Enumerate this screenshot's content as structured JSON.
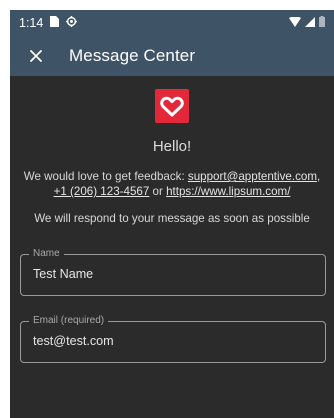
{
  "status_bar": {
    "time": "1:14",
    "left_icons": [
      "sim-card-icon",
      "settings-gear-icon"
    ],
    "right_icons": [
      "wifi-icon",
      "cell-signal-icon",
      "battery-icon"
    ]
  },
  "app_bar": {
    "close_icon": "close-icon",
    "title": "Message Center"
  },
  "colors": {
    "app_bar_bg": "#3e5366",
    "content_bg": "#2b2b2b",
    "logo_bg": "#e3283a"
  },
  "greeting": "Hello!",
  "feedback": {
    "prefix": "We would love to get feedback: ",
    "email_link": "support@apptentive.com",
    "separator": ", ",
    "phone_link": "+1 (206) 123-4567",
    "or_text": " or ",
    "url_link": "https://www.lipsum.com/"
  },
  "respond_text": "We will respond to your message as soon as possible",
  "form": {
    "name": {
      "label": "Name",
      "value": "Test Name"
    },
    "email": {
      "label": "Email (required)",
      "value": "test@test.com"
    }
  }
}
